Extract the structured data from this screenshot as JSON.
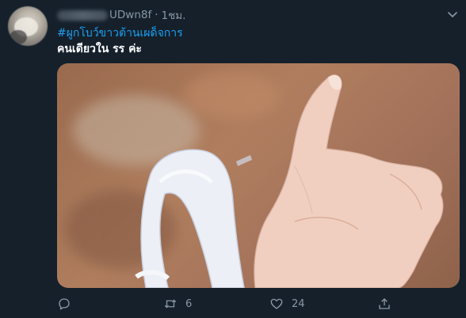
{
  "tweet": {
    "handle": "UDwn8f",
    "separator": "·",
    "time": "1ชม.",
    "hashtag": "#ผูกโบว์ขาวต้านเผด็จการ",
    "text": "คนเดียวใน รร ค่ะ"
  },
  "actions": {
    "reply_count": "",
    "retweet_count": "6",
    "like_count": "24"
  },
  "icons": {
    "reply": "reply-icon",
    "retweet": "retweet-icon",
    "like": "heart-icon",
    "share": "share-icon",
    "more": "chevron-down-icon"
  },
  "colors": {
    "background": "#15202b",
    "secondary_text": "#8899a6",
    "link": "#1da1f2"
  }
}
